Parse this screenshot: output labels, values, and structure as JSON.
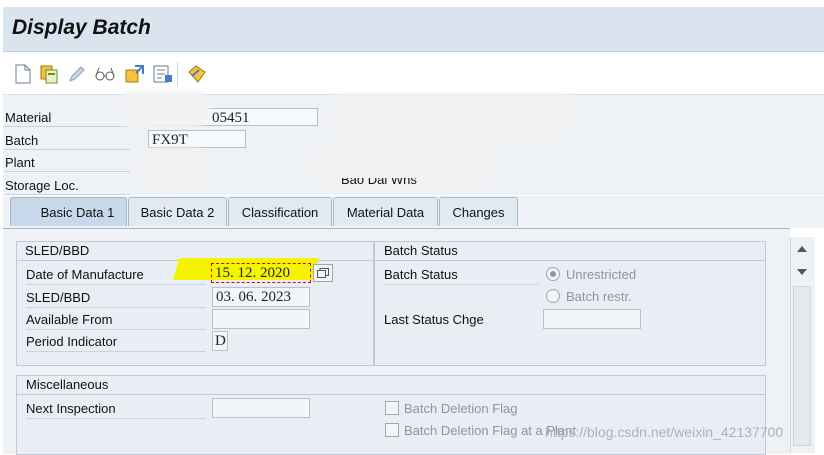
{
  "window": {
    "title": "Display Batch"
  },
  "toolbar": {
    "icons": [
      "new-document-icon",
      "copy-icon",
      "edit-pencil-icon",
      "display-glasses-icon",
      "where-used-icon",
      "report-list-icon",
      "other-object-icon"
    ]
  },
  "header": {
    "material_label": "Material",
    "material_value": "05451",
    "batch_label": "Batch",
    "batch_value": "FX9T",
    "plant_label": "Plant",
    "storage_label": "Storage Loc.",
    "storage_desc_partial": "Bao Dai Whs"
  },
  "tabs": [
    {
      "label": "Basic Data 1",
      "active": true
    },
    {
      "label": "Basic Data 2",
      "active": false
    },
    {
      "label": "Classification",
      "active": false
    },
    {
      "label": "Material Data",
      "active": false
    },
    {
      "label": "Changes",
      "active": false
    }
  ],
  "sled": {
    "title": "SLED/BBD",
    "dom_label": "Date of Manufacture",
    "dom_value": "15. 12. 2020",
    "sled_label": "SLED/BBD",
    "sled_value": "03. 06. 2023",
    "available_label": "Available From",
    "available_value": "",
    "period_label": "Period Indicator",
    "period_value": "D"
  },
  "batch_status": {
    "title": "Batch Status",
    "status_label": "Batch Status",
    "opt_unrestricted": "Unrestricted",
    "opt_restricted": "Batch restr.",
    "selected": "Unrestricted",
    "last_change_label": "Last Status Chge",
    "last_change_value": ""
  },
  "misc": {
    "title": "Miscellaneous",
    "next_inspection_label": "Next Inspection",
    "next_inspection_value": "",
    "deletion_flag_label": "Batch Deletion Flag",
    "deletion_flag_plant_label": "Batch Deletion Flag at a Plant"
  },
  "watermark": "https://blog.csdn.net/weixin_42137700",
  "colors": {
    "highlight": "#f4f400",
    "focus_border": "#d0021b"
  }
}
